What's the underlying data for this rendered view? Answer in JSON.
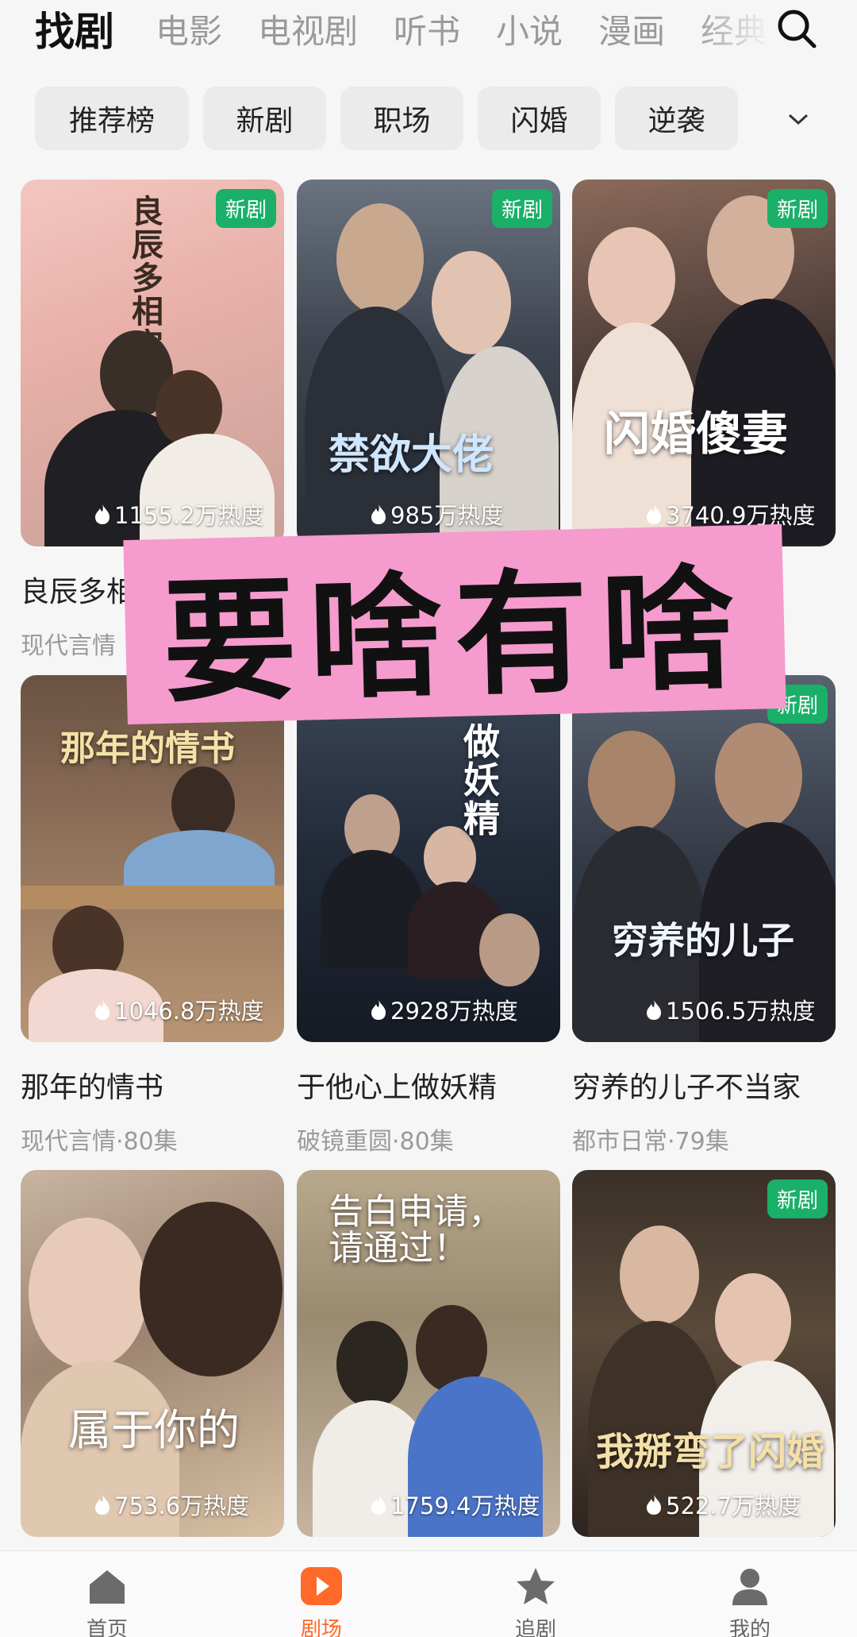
{
  "top_tabs": [
    "找剧",
    "电影",
    "电视剧",
    "听书",
    "小说",
    "漫画",
    "经典"
  ],
  "filters": [
    "推荐榜",
    "新剧",
    "职场",
    "闪婚",
    "逆袭"
  ],
  "banner_text": "要啥有啥",
  "cards": [
    {
      "badge": "新剧",
      "heat": "1155.2万热度",
      "title": "良辰多相宜",
      "meta": "现代言情",
      "poster_text": "良辰多相宜"
    },
    {
      "badge": "新剧",
      "heat": "985万热度",
      "title": "",
      "meta": "",
      "poster_text": "禁欲大佬"
    },
    {
      "badge": "新剧",
      "heat": "3740.9万热度",
      "title": "",
      "meta": "",
      "poster_text": "闪婚傻妻"
    },
    {
      "badge": "",
      "heat": "1046.8万热度",
      "title": "那年的情书",
      "meta": "现代言情·80集",
      "poster_text": "那年的情书"
    },
    {
      "badge": "",
      "heat": "2928万热度",
      "title": "于他心上做妖精",
      "meta": "破镜重圆·80集",
      "poster_text": "做妖精"
    },
    {
      "badge": "新剧",
      "heat": "1506.5万热度",
      "title": "穷养的儿子不当家",
      "meta": "都市日常·79集",
      "poster_text": "穷养的儿子"
    },
    {
      "badge": "",
      "heat": "753.6万热度",
      "title": "",
      "meta": "",
      "poster_text": "属于你的"
    },
    {
      "badge": "",
      "heat": "1759.4万热度",
      "title": "",
      "meta": "",
      "poster_text": "告白申请，请通过！"
    },
    {
      "badge": "新剧",
      "heat": "522.7万热度",
      "title": "",
      "meta": "",
      "poster_text": "我掰弯了闪婚"
    }
  ],
  "bottom_tabs": [
    "首页",
    "剧场",
    "追剧",
    "我的"
  ],
  "colors": {
    "accent": "#ff6a2a",
    "badge": "#1bb06a",
    "banner": "#f59bcd"
  }
}
